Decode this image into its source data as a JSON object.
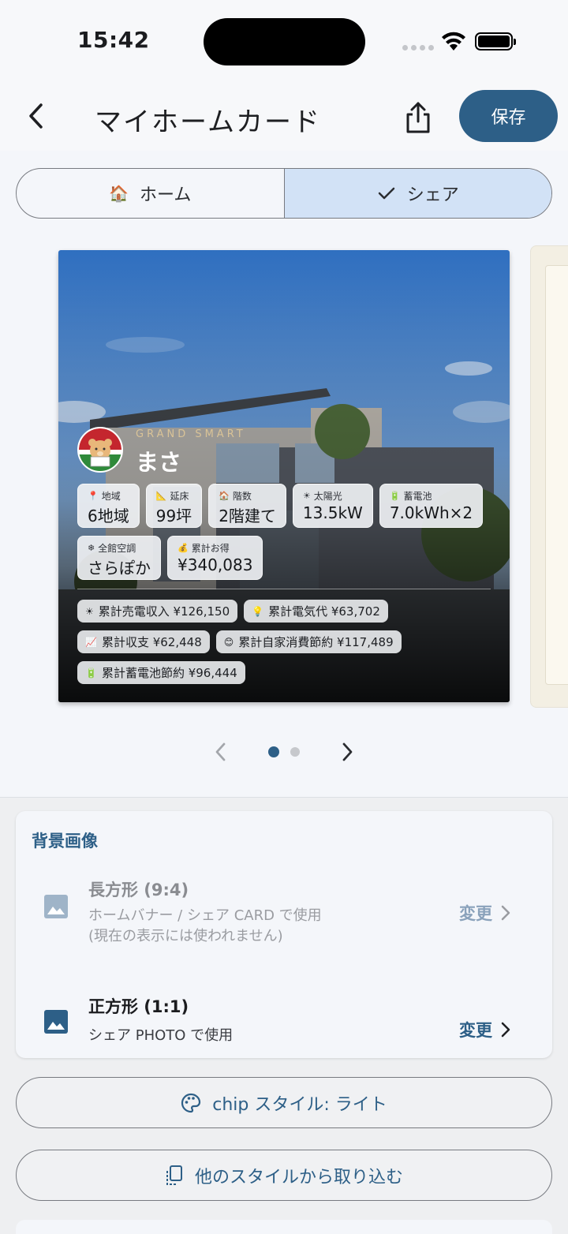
{
  "status_bar": {
    "time": "15:42"
  },
  "header": {
    "title": "マイホームカード",
    "save_label": "保存"
  },
  "tabs": [
    {
      "icon": "house-icon",
      "label": "ホーム",
      "active": false
    },
    {
      "icon": "check-icon",
      "label": "シェア",
      "active": true
    }
  ],
  "card": {
    "brand": "GRAND SMART",
    "user_name": "まさ",
    "stats": [
      {
        "icon": "pin-icon",
        "label": "地域",
        "value": "6地域"
      },
      {
        "icon": "ruler-icon",
        "label": "延床",
        "value": "99坪"
      },
      {
        "icon": "house-icon",
        "label": "階数",
        "value": "2階建て"
      },
      {
        "icon": "sun-icon",
        "label": "太陽光",
        "value": "13.5kW"
      },
      {
        "icon": "battery-icon",
        "label": "蓄電池",
        "value": "7.0kWh×2"
      },
      {
        "icon": "snowflake-icon",
        "label": "全館空調",
        "value": "さらぽか"
      },
      {
        "icon": "moneybag-icon",
        "label": "累計お得",
        "value": "¥340,083"
      }
    ],
    "totals": [
      {
        "icon": "sun-icon",
        "text": "累計売電収入 ¥126,150"
      },
      {
        "icon": "lightbulb-icon",
        "text": "累計電気代 ¥63,702"
      },
      {
        "icon": "chart-icon",
        "text": "累計収支 ¥62,448"
      },
      {
        "icon": "smile-icon",
        "text": "累計自家消費節約 ¥117,489"
      },
      {
        "icon": "battery-icon",
        "text": "累計蓄電池節約 ¥96,444"
      }
    ]
  },
  "pager": {
    "current": 1,
    "total": 2
  },
  "background_panel": {
    "title": "背景画像",
    "rows": [
      {
        "title": "長方形 (9:4)",
        "sub1": "ホームバナー / シェア CARD で使用",
        "sub2": "(現在の表示には使われません)",
        "action": "変更",
        "enabled": false
      },
      {
        "title": "正方形 (1:1)",
        "sub1": "シェア PHOTO で使用",
        "action": "変更",
        "enabled": true
      }
    ]
  },
  "buttons": {
    "chip_style": "chip スタイル: ライト",
    "import_style": "他のスタイルから取り込む"
  },
  "colors": {
    "accent": "#2d5f87",
    "active_tab": "#d2e2f6"
  }
}
